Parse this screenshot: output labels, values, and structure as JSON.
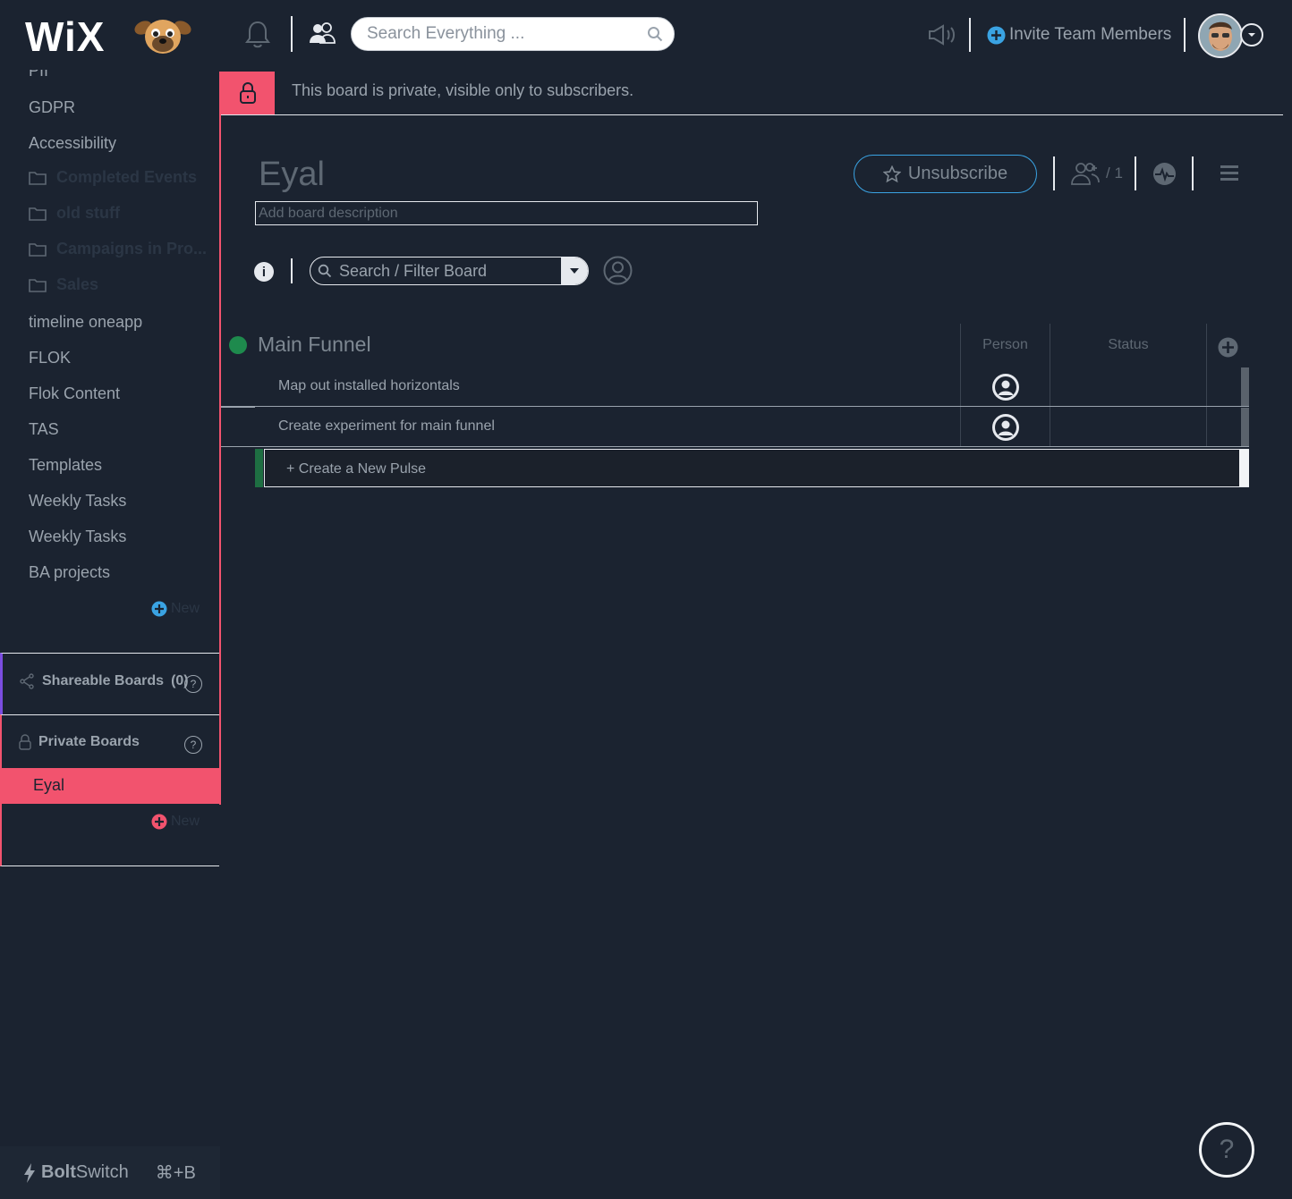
{
  "header": {
    "logo_text": "WiX",
    "search_placeholder": "Search Everything ...",
    "invite_label": "Invite Team Members"
  },
  "sidebar": {
    "items": [
      {
        "label": "PII",
        "type": "board"
      },
      {
        "label": "GDPR",
        "type": "board"
      },
      {
        "label": "Accessibility",
        "type": "board"
      },
      {
        "label": "Completed Events",
        "type": "folder"
      },
      {
        "label": "old stuff",
        "type": "folder"
      },
      {
        "label": "Campaigns in Pro...",
        "type": "folder"
      },
      {
        "label": "Sales",
        "type": "folder"
      },
      {
        "label": "timeline oneapp",
        "type": "board"
      },
      {
        "label": "FLOK",
        "type": "board"
      },
      {
        "label": "Flok Content",
        "type": "board"
      },
      {
        "label": "TAS",
        "type": "board"
      },
      {
        "label": "Templates",
        "type": "board"
      },
      {
        "label": "Weekly Tasks",
        "type": "board"
      },
      {
        "label": "Weekly Tasks",
        "type": "board"
      },
      {
        "label": "BA projects",
        "type": "board"
      }
    ],
    "new_label": "New",
    "shareable_label": "Shareable Boards",
    "shareable_count": "(0)",
    "private_label": "Private Boards",
    "private_boards": [
      {
        "label": "Eyal",
        "active": true
      }
    ],
    "private_new_label": "New",
    "boltswitch_bold": "Bolt",
    "boltswitch_rest": "Switch",
    "boltswitch_shortcut": "⌘+B"
  },
  "banner": {
    "text": "This board is private, visible only to subscribers."
  },
  "board": {
    "title": "Eyal",
    "description_placeholder": "Add board description",
    "unsubscribe_label": "Unsubscribe",
    "subscribers_count": "/ 1",
    "filter_label": "Search / Filter Board"
  },
  "group": {
    "title": "Main Funnel",
    "color": "#1e8a4d",
    "columns": [
      "Person",
      "Status"
    ],
    "rows": [
      {
        "name": "Map out installed horizontals"
      },
      {
        "name": "Create experiment for main funnel"
      }
    ],
    "new_pulse_label": "+ Create a New Pulse"
  },
  "help": {
    "label": "?"
  },
  "colors": {
    "accent_pink": "#f2536e",
    "accent_blue": "#3aa3e3",
    "background": "#1b2330"
  }
}
